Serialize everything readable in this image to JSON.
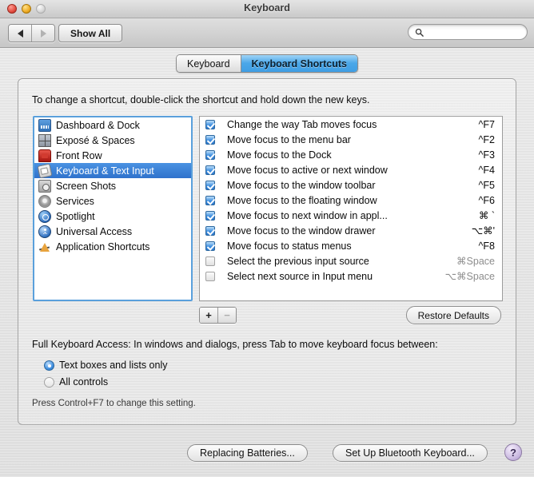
{
  "window": {
    "title": "Keyboard",
    "traffic_lights": [
      "close-button",
      "minimize-button",
      "zoom-button"
    ]
  },
  "toolbar": {
    "back_label": "◀",
    "forward_label": "▶",
    "show_all_label": "Show All",
    "search": {
      "value": "",
      "placeholder": ""
    }
  },
  "tabs": [
    {
      "label": "Keyboard",
      "selected": false
    },
    {
      "label": "Keyboard Shortcuts",
      "selected": true
    }
  ],
  "panel": {
    "hint": "To change a shortcut, double-click the shortcut and hold down the new keys.",
    "sidebar": {
      "items": [
        {
          "label": "Dashboard & Dock",
          "icon": "dashboard-icon",
          "selected": false
        },
        {
          "label": "Exposé & Spaces",
          "icon": "expose-icon",
          "selected": false
        },
        {
          "label": "Front Row",
          "icon": "front-row-icon",
          "selected": false
        },
        {
          "label": "Keyboard & Text Input",
          "icon": "keyboard-icon",
          "selected": true
        },
        {
          "label": "Screen Shots",
          "icon": "screenshot-icon",
          "selected": false
        },
        {
          "label": "Services",
          "icon": "services-gear-icon",
          "selected": false
        },
        {
          "label": "Spotlight",
          "icon": "spotlight-icon",
          "selected": false
        },
        {
          "label": "Universal Access",
          "icon": "universal-access-icon",
          "selected": false
        },
        {
          "label": "Application Shortcuts",
          "icon": "application-shortcuts-icon",
          "selected": false
        }
      ]
    },
    "shortcuts": {
      "rows": [
        {
          "name": "Change the way Tab moves focus",
          "keys": "^F7",
          "checked": true
        },
        {
          "name": "Move focus to the menu bar",
          "keys": "^F2",
          "checked": true
        },
        {
          "name": "Move focus to the Dock",
          "keys": "^F3",
          "checked": true
        },
        {
          "name": "Move focus to active or next window",
          "keys": "^F4",
          "checked": true
        },
        {
          "name": "Move focus to the window toolbar",
          "keys": "^F5",
          "checked": true
        },
        {
          "name": "Move focus to the floating window",
          "keys": "^F6",
          "checked": true
        },
        {
          "name": "Move focus to next window in appl...",
          "keys": "⌘ `",
          "checked": true
        },
        {
          "name": "Move focus to the window drawer",
          "keys": "⌥⌘'",
          "checked": true
        },
        {
          "name": "Move focus to status menus",
          "keys": "^F8",
          "checked": true
        },
        {
          "name": "Select the previous input source",
          "keys": "⌘Space",
          "checked": false
        },
        {
          "name": "Select next source in Input menu",
          "keys": "⌥⌘Space",
          "checked": false
        }
      ]
    },
    "add_label": "+",
    "remove_label": "−",
    "restore_defaults_label": "Restore Defaults",
    "full_keyboard_access_label": "Full Keyboard Access: In windows and dialogs, press Tab to move keyboard focus between:",
    "radios": [
      {
        "label": "Text boxes and lists only",
        "selected": true
      },
      {
        "label": "All controls",
        "selected": false
      }
    ],
    "note": "Press Control+F7 to change this setting."
  },
  "footer": {
    "replacing_batteries_label": "Replacing Batteries...",
    "set_up_bluetooth_label": "Set Up Bluetooth Keyboard...",
    "help_label": "?"
  }
}
